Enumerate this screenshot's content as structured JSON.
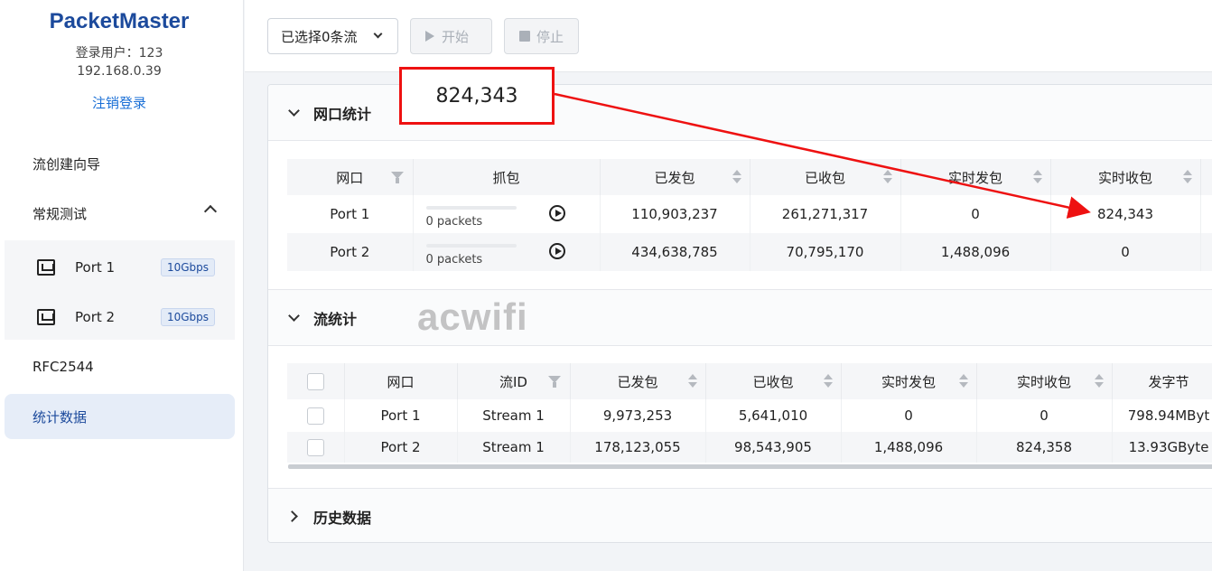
{
  "sidebar": {
    "brand": "PacketMaster",
    "user_line": "登录用户：123",
    "ip": "192.168.0.39",
    "logout": "注销登录",
    "nav": {
      "wizard": "流创建向导",
      "regular": "常规测试",
      "rfc": "RFC2544",
      "stats": "统计数据"
    },
    "ports": [
      {
        "label": "Port 1",
        "speed": "10Gbps"
      },
      {
        "label": "Port 2",
        "speed": "10Gbps"
      }
    ]
  },
  "toolbar": {
    "select_label": "已选择0条流",
    "start_label": "开始",
    "stop_label": "停止"
  },
  "annotation": {
    "value": "824,343"
  },
  "watermark": "acwifi",
  "port_stats": {
    "title": "网口统计",
    "headers": [
      "网口",
      "抓包",
      "已发包",
      "已收包",
      "实时发包",
      "实时收包"
    ],
    "rows": [
      {
        "port": "Port 1",
        "capture": "0 packets",
        "capture_progress": 0,
        "tx": "110,903,237",
        "rx": "261,271,317",
        "rt_tx": "0",
        "rt_rx": "824,343"
      },
      {
        "port": "Port 2",
        "capture": "0 packets",
        "capture_progress": 0,
        "tx": "434,638,785",
        "rx": "70,795,170",
        "rt_tx": "1,488,096",
        "rt_rx": "0"
      }
    ]
  },
  "flow_stats": {
    "title": "流统计",
    "headers": [
      "网口",
      "流ID",
      "已发包",
      "已收包",
      "实时发包",
      "实时收包",
      "发字节"
    ],
    "rows": [
      {
        "port": "Port 1",
        "stream": "Stream 1",
        "tx": "9,973,253",
        "rx": "5,641,010",
        "rt_tx": "0",
        "rt_rx": "0",
        "bytes": "798.94MByt"
      },
      {
        "port": "Port 2",
        "stream": "Stream 1",
        "tx": "178,123,055",
        "rx": "98,543,905",
        "rt_tx": "1,488,096",
        "rt_rx": "824,358",
        "bytes": "13.93GByte"
      }
    ]
  },
  "history": {
    "title": "历史数据"
  },
  "colors": {
    "brand": "#1c4a9c",
    "link": "#1a6fd6",
    "annotation": "#e11111"
  }
}
